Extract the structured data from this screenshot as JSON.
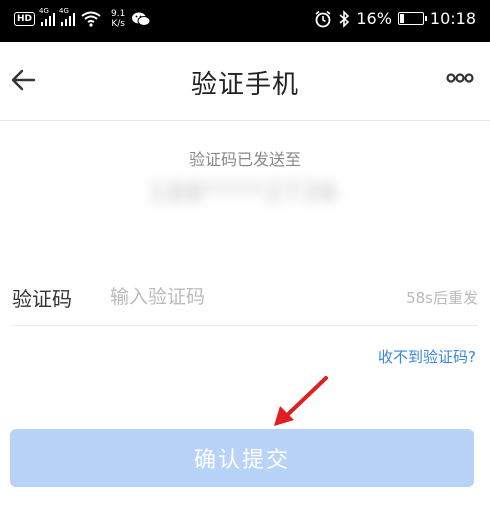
{
  "status_bar": {
    "hd": "HD",
    "signal1": "4G",
    "signal2": "4G",
    "speed_value": "9.1",
    "speed_unit": "K/s",
    "battery": "16%",
    "time": "10:18"
  },
  "nav": {
    "title": "验证手机"
  },
  "verify": {
    "sent_label": "验证码已发送至",
    "phone_masked": "188****2736"
  },
  "code_field": {
    "label": "验证码",
    "placeholder": "输入验证码",
    "value": "",
    "resend": "58s后重发"
  },
  "no_code_link": "收不到验证码?",
  "submit_label": "确认提交",
  "colors": {
    "accent": "#3a86e4",
    "button_disabled": "#b8d2f8",
    "annotation": "#e02020"
  }
}
